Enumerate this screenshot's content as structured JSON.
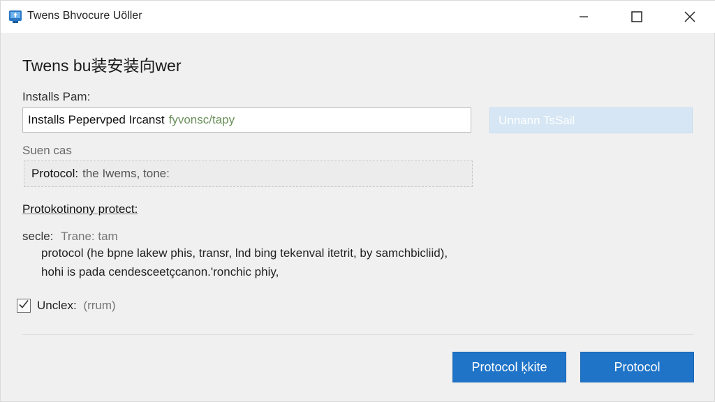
{
  "window": {
    "title": "Twens Bhvocure Uöller",
    "icon": "installer-app-icon",
    "controls": [
      "minimize-icon",
      "maximize-icon",
      "close-icon"
    ]
  },
  "main": {
    "heading": "Twens bu装安装向wer",
    "path_label": "Installs Pam:",
    "path_value": "Installs Pepervped Ircanst",
    "path_hint": "fyvonsc/tapy",
    "browse_label": "Unnann TsSail",
    "source_label": "Suen cas",
    "source_key": "Protocol:",
    "source_value": "the Iwems, tone:",
    "section_title": "Protokotinony protect:",
    "desc_key": "secle:",
    "desc_key_value": "Trane: tam",
    "desc_line1": "protocol (he bpne lakew phis, transr, lnd bing tekenval itetrit, by samchbicliid),",
    "desc_line2": "hohi is pada cendesceetçcanon.'ronchic phiy,",
    "checkbox_label": "Unclex:",
    "checkbox_hint": "(rrum)",
    "checkbox_checked": true
  },
  "footer": {
    "secondary_button": "Protocol ķkite",
    "primary_button": "Protocol"
  },
  "colors": {
    "accent": "#1f74c8",
    "disabled_button": "#d6e6f4",
    "background": "#f0f0f0",
    "titlebar": "#ffffff"
  }
}
